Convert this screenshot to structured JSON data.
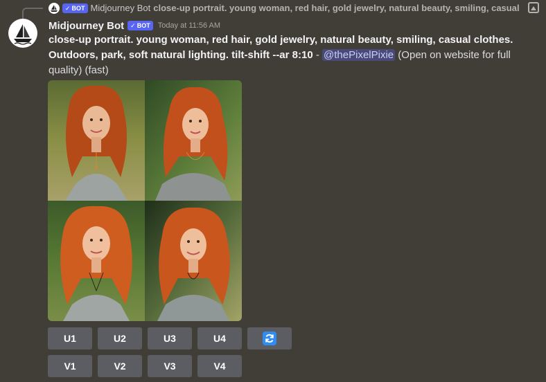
{
  "reply": {
    "bot_name": "Midjourney Bot",
    "badge": "BOT",
    "text": "close-up portrait. young woman, red hair, gold jewelry, natural beauty, smiling, casual"
  },
  "message": {
    "bot_name": "Midjourney Bot",
    "badge": "BOT",
    "timestamp": "Today at 11:56 AM",
    "prompt": "close-up portrait. young woman, red hair, gold jewelry, natural beauty, smiling, casual clothes. Outdoors, park, soft natural lighting. tilt-shift --ar 8:10",
    "separator": " - ",
    "mention": "@thePixelPixie",
    "suffix": " (Open on website for full quality) (fast)"
  },
  "buttons": {
    "upscale": [
      "U1",
      "U2",
      "U3",
      "U4"
    ],
    "variation": [
      "V1",
      "V2",
      "V3",
      "V4"
    ],
    "reroll_icon": "refresh-icon"
  },
  "colors": {
    "background": "#413d37",
    "button": "#5b5d62",
    "badge": "#5865f2",
    "mention_text": "#c9cdfb",
    "refresh_icon": "#2f8cf0"
  }
}
